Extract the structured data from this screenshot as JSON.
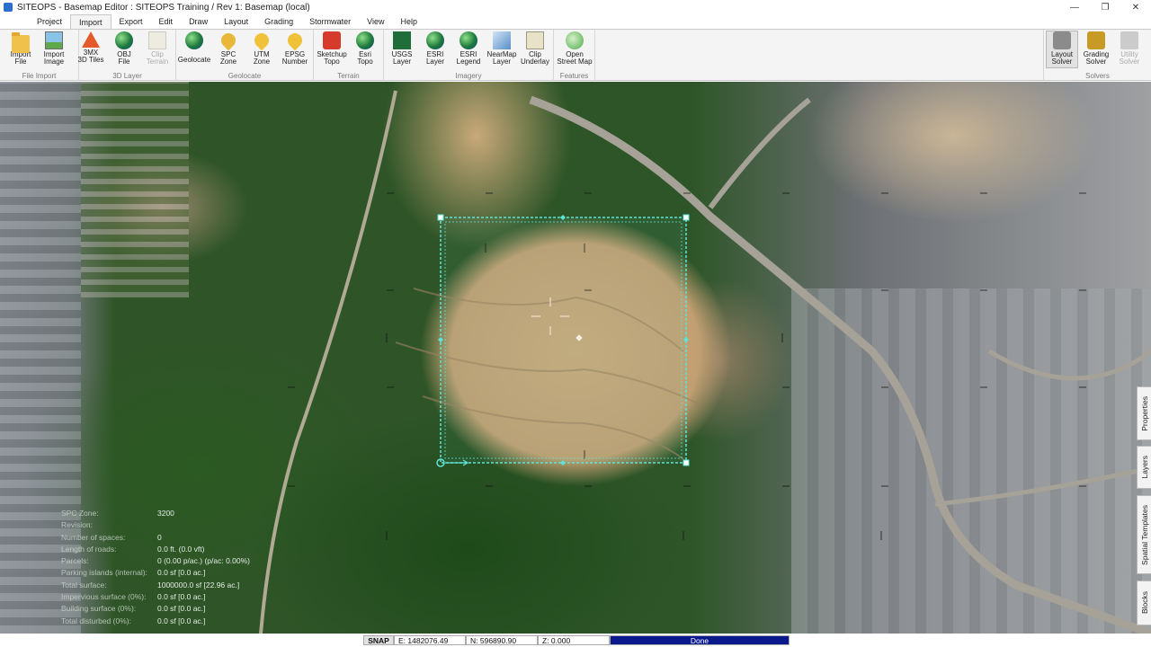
{
  "window": {
    "title": "SITEOPS - Basemap Editor : SITEOPS Training / Rev 1: Basemap (local)",
    "controls": [
      "—",
      "❐",
      "✕"
    ]
  },
  "menu": {
    "tabs": [
      "Project",
      "Import",
      "Export",
      "Edit",
      "Draw",
      "Layout",
      "Grading",
      "Stormwater",
      "View",
      "Help"
    ],
    "active": "Import"
  },
  "ribbon": {
    "groups": [
      {
        "label": "File Import",
        "buttons": [
          "Import\nFile",
          "Import\nImage"
        ]
      },
      {
        "label": "3D Layer",
        "buttons": [
          "3MX\n3D Tiles",
          "OBJ\nFile",
          "Clip\nTerrain"
        ]
      },
      {
        "label": "Geolocate",
        "buttons": [
          "Geolocate",
          "SPC\nZone",
          "UTM\nZone",
          "EPSG\nNumber"
        ]
      },
      {
        "label": "Terrain",
        "buttons": [
          "Sketchup\nTopo",
          "Esri\nTopo"
        ]
      },
      {
        "label": "Imagery",
        "buttons": [
          "USGS\nLayer",
          "ESRI\nLayer",
          "ESRI\nLegend",
          "NearMap\nLayer",
          "Clip\nUnderlay"
        ]
      },
      {
        "label": "Features",
        "buttons": [
          "Open\nStreet Map"
        ]
      },
      {
        "label": "Solvers",
        "buttons": [
          "Layout\nSolver",
          "Grading\nSolver",
          "Utility\nSolver"
        ]
      }
    ]
  },
  "readout": {
    "rows": [
      {
        "k": "SPC Zone:",
        "v": "3200"
      },
      {
        "k": "Revision:",
        "v": ""
      },
      {
        "k": "Number of spaces:",
        "v": "0"
      },
      {
        "k": "Length of roads:",
        "v": "0.0 ft. (0.0 vft)"
      },
      {
        "k": "Parcels:",
        "v": "0 (0.00 p/ac.)   (p/ac: 0.00%)"
      },
      {
        "k": "Parking islands (internal):",
        "v": "0.0 sf [0.0 ac.]"
      },
      {
        "k": "Total surface:",
        "v": "1000000.0 sf [22.96 ac.]"
      },
      {
        "k": "Impervious surface (0%):",
        "v": "0.0 sf [0.0 ac.]"
      },
      {
        "k": "Building surface (0%):",
        "v": "0.0 sf [0.0 ac.]"
      },
      {
        "k": "Total disturbed (0%):",
        "v": "0.0 sf [0.0 ac.]"
      }
    ]
  },
  "side_tabs": [
    "Properties",
    "Layers",
    "Spatial Templates",
    "Blocks"
  ],
  "status": {
    "snap": "SNAP",
    "e": "E: 1482076.49",
    "n": "N: 596890.90",
    "z": "Z: 0.000",
    "progress": "Done"
  }
}
